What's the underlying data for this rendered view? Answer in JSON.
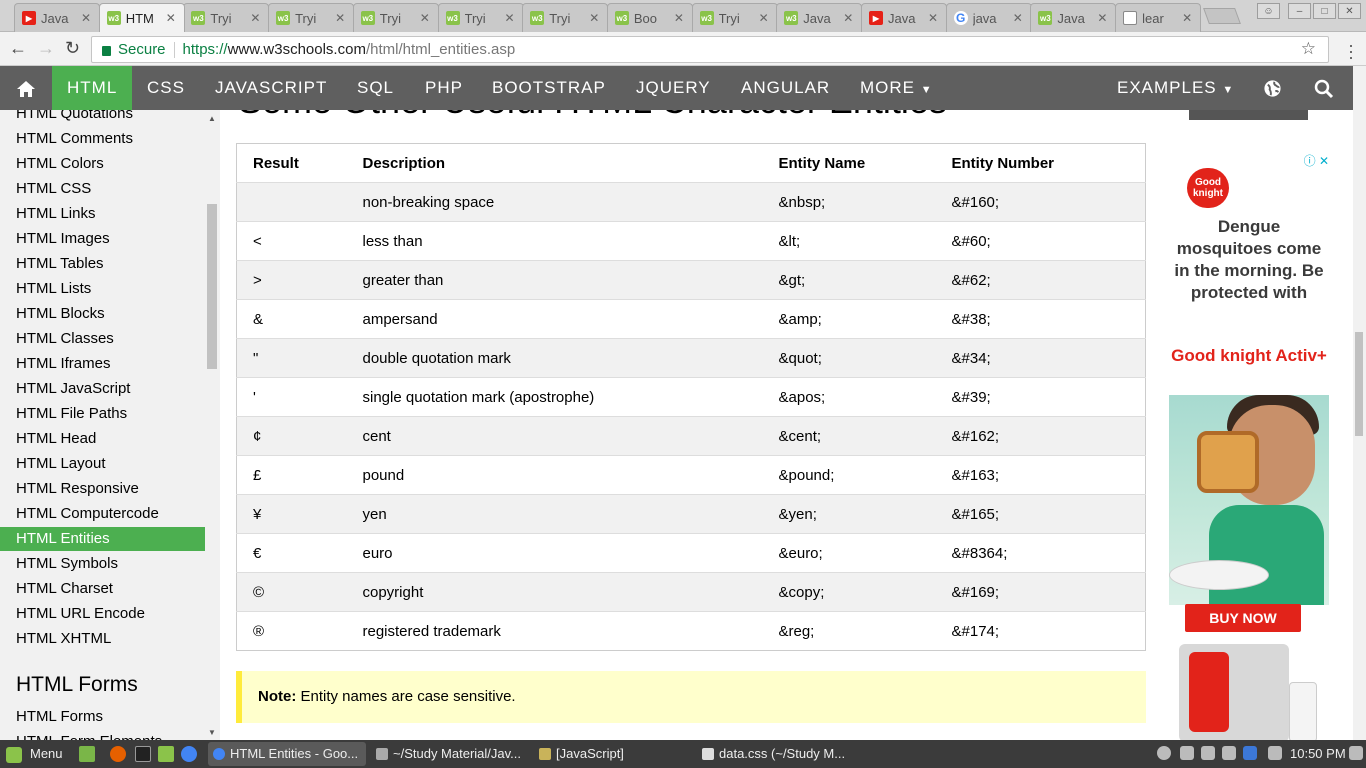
{
  "browser": {
    "tabs": [
      {
        "title": "Java",
        "favicon": "youtube-icon"
      },
      {
        "title": "HTM",
        "favicon": "w3schools-icon",
        "active": true
      },
      {
        "title": "Tryi",
        "favicon": "w3schools-icon"
      },
      {
        "title": "Tryi",
        "favicon": "w3schools-icon"
      },
      {
        "title": "Tryi",
        "favicon": "w3schools-icon"
      },
      {
        "title": "Tryi",
        "favicon": "w3schools-icon"
      },
      {
        "title": "Tryi",
        "favicon": "w3schools-icon"
      },
      {
        "title": "Boo",
        "favicon": "w3schools-icon"
      },
      {
        "title": "Tryi",
        "favicon": "w3schools-icon"
      },
      {
        "title": "Java",
        "favicon": "w3schools-icon"
      },
      {
        "title": "Java",
        "favicon": "youtube-icon"
      },
      {
        "title": "java",
        "favicon": "google-icon"
      },
      {
        "title": "Java",
        "favicon": "w3schools-icon"
      },
      {
        "title": "lear",
        "favicon": "document-icon"
      }
    ],
    "address": {
      "secure_label": "Secure",
      "scheme": "https://",
      "host": "www.w3schools.com",
      "path": "/html/html_entities.asp"
    }
  },
  "topnav": {
    "home_icon": "home-icon",
    "items": [
      "HTML",
      "CSS",
      "JAVASCRIPT",
      "SQL",
      "PHP",
      "BOOTSTRAP",
      "JQUERY",
      "ANGULAR",
      "MORE"
    ],
    "active": "HTML",
    "examples": "EXAMPLES",
    "globe_icon": "globe-icon",
    "search_icon": "search-icon",
    "accent_color": "#4caf50",
    "bar_color": "#5f5f5f"
  },
  "sidebar": {
    "items": [
      "HTML Quotations",
      "HTML Comments",
      "HTML Colors",
      "HTML CSS",
      "HTML Links",
      "HTML Images",
      "HTML Tables",
      "HTML Lists",
      "HTML Blocks",
      "HTML Classes",
      "HTML Iframes",
      "HTML JavaScript",
      "HTML File Paths",
      "HTML Head",
      "HTML Layout",
      "HTML Responsive",
      "HTML Computercode",
      "HTML Entities",
      "HTML Symbols",
      "HTML Charset",
      "HTML URL Encode",
      "HTML XHTML"
    ],
    "active": "HTML Entities",
    "section_title": "HTML Forms",
    "section_items": [
      "HTML Forms",
      "HTML Form Elements"
    ]
  },
  "main": {
    "heading": "Some Other Useful HTML Character Entities",
    "table": {
      "headers": [
        "Result",
        "Description",
        "Entity Name",
        "Entity Number"
      ],
      "rows": [
        [
          " ",
          "non-breaking space",
          "&nbsp;",
          "&#160;"
        ],
        [
          "<",
          "less than",
          "&lt;",
          "&#60;"
        ],
        [
          ">",
          "greater than",
          "&gt;",
          "&#62;"
        ],
        [
          "&",
          "ampersand",
          "&amp;",
          "&#38;"
        ],
        [
          "\"",
          "double quotation mark",
          "&quot;",
          "&#34;"
        ],
        [
          "'",
          "single quotation mark (apostrophe)",
          "&apos;",
          "&#39;"
        ],
        [
          "¢",
          "cent",
          "&cent;",
          "&#162;"
        ],
        [
          "£",
          "pound",
          "&pound;",
          "&#163;"
        ],
        [
          "¥",
          "yen",
          "&yen;",
          "&#165;"
        ],
        [
          "€",
          "euro",
          "&euro;",
          "&#8364;"
        ],
        [
          "©",
          "copyright",
          "&copy;",
          "&#169;"
        ],
        [
          "®",
          "registered trademark",
          "&reg;",
          "&#174;"
        ]
      ]
    },
    "note": {
      "label": "Note:",
      "text": " Entity names are case sensitive."
    }
  },
  "ad": {
    "logo": "Good knight",
    "text": "Dengue mosquitoes come in the morning. Be protected with",
    "brand": "Good knight Activ+",
    "button": "BUY NOW",
    "info_icon": "ad-info-icon",
    "close_icon": "ad-close-icon"
  },
  "taskbar": {
    "menu": "Menu",
    "windows": [
      "HTML Entities - Goo...",
      "~/Study Material/Jav...",
      "[JavaScript]",
      "data.css (~/Study M..."
    ],
    "clock": "10:50 PM"
  }
}
